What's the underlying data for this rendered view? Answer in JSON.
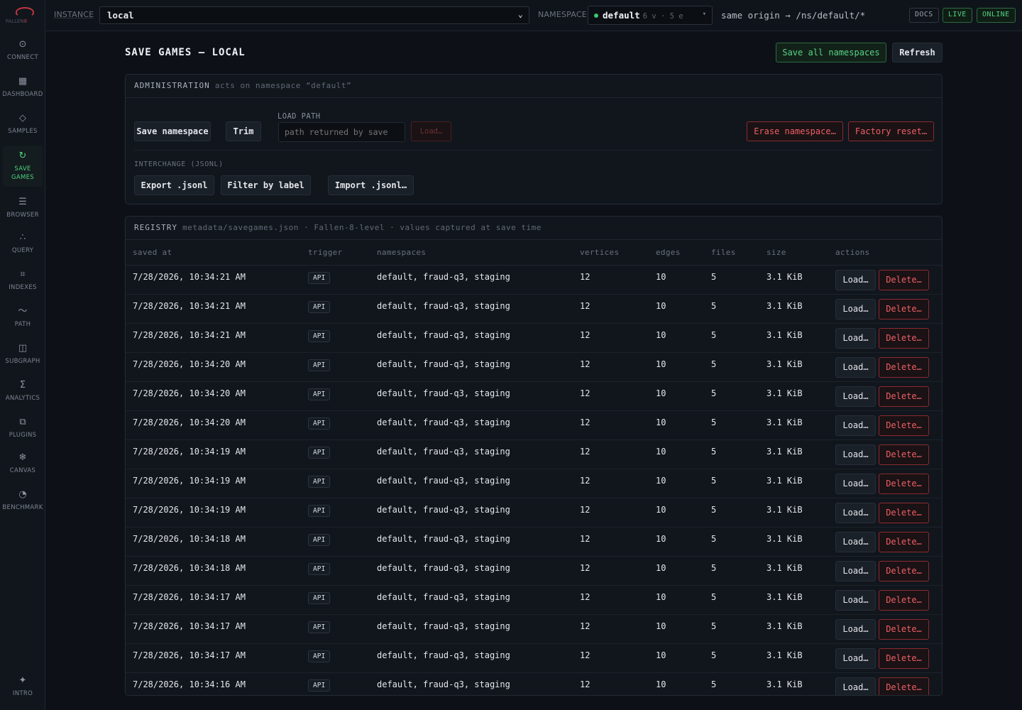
{
  "brand": {
    "wordmark_left": "FALLEN",
    "wordmark_right": "8"
  },
  "sidebar": {
    "items": [
      {
        "label": "CONNECT",
        "icon": "target-icon",
        "glyph": "⊙"
      },
      {
        "label": "DASHBOARD",
        "icon": "grid-icon",
        "glyph": "▦"
      },
      {
        "label": "SAMPLES",
        "icon": "diamond-icon",
        "glyph": "◇"
      },
      {
        "label": "SAVE GAMES",
        "icon": "refresh-icon",
        "glyph": "↻",
        "active": true
      },
      {
        "label": "BROWSER",
        "icon": "list-icon",
        "glyph": "☰"
      },
      {
        "label": "QUERY",
        "icon": "nodes-icon",
        "glyph": "∴"
      },
      {
        "label": "INDEXES",
        "icon": "frame-icon",
        "glyph": "⌗"
      },
      {
        "label": "PATH",
        "icon": "wave-icon",
        "glyph": "〜"
      },
      {
        "label": "SUBGRAPH",
        "icon": "square-icon",
        "glyph": "◫"
      },
      {
        "label": "ANALYTICS",
        "icon": "sigma-icon",
        "glyph": "Σ"
      },
      {
        "label": "PLUGINS",
        "icon": "plugin-icon",
        "glyph": "⧉"
      },
      {
        "label": "CANVAS",
        "icon": "canvas-icon",
        "glyph": "❄"
      },
      {
        "label": "BENCHMARK",
        "icon": "gauge-icon",
        "glyph": "◔"
      }
    ],
    "intro": {
      "label": "INTRO",
      "icon": "sparkle-icon",
      "glyph": "✦"
    }
  },
  "topbar": {
    "instance_label": "INSTANCE",
    "instance_value": "local",
    "namespace_label": "NAMESPACE",
    "namespace_value": "default",
    "namespace_counts": "6 v · 5 e",
    "origin": "same origin → /ns/default/*",
    "docs": "DOCS",
    "live": "LIVE",
    "online": "ONLINE"
  },
  "page": {
    "title": "SAVE GAMES — LOCAL",
    "save_all_label": "Save all namespaces",
    "refresh_label": "Refresh"
  },
  "admin": {
    "title": "ADMINISTRATION",
    "subtitle": "acts on namespace “default”",
    "save_namespace": "Save namespace",
    "trim": "Trim",
    "load_path_label": "LOAD PATH",
    "load_path_placeholder": "path returned by save",
    "load_button": "Load…",
    "erase_namespace": "Erase namespace…",
    "factory_reset": "Factory reset…",
    "interchange_label": "INTERCHANGE (JSONL)",
    "export": "Export .jsonl",
    "filter": "Filter by label",
    "import": "Import .jsonl…"
  },
  "registry": {
    "title": "REGISTRY",
    "path": "metadata/savegames.json",
    "note1": "Fallen-8-level",
    "note2": "values captured at save time",
    "columns": [
      "saved at",
      "trigger",
      "namespaces",
      "vertices",
      "edges",
      "files",
      "size",
      "actions"
    ],
    "load_label": "Load…",
    "delete_label": "Delete…",
    "rows": [
      {
        "saved_at": "7/28/2026, 10:34:21 AM",
        "trigger": "API",
        "namespaces": "default, fraud-q3, staging",
        "vertices": "12",
        "edges": "10",
        "files": "5",
        "size": "3.1 KiB"
      },
      {
        "saved_at": "7/28/2026, 10:34:21 AM",
        "trigger": "API",
        "namespaces": "default, fraud-q3, staging",
        "vertices": "12",
        "edges": "10",
        "files": "5",
        "size": "3.1 KiB"
      },
      {
        "saved_at": "7/28/2026, 10:34:21 AM",
        "trigger": "API",
        "namespaces": "default, fraud-q3, staging",
        "vertices": "12",
        "edges": "10",
        "files": "5",
        "size": "3.1 KiB"
      },
      {
        "saved_at": "7/28/2026, 10:34:20 AM",
        "trigger": "API",
        "namespaces": "default, fraud-q3, staging",
        "vertices": "12",
        "edges": "10",
        "files": "5",
        "size": "3.1 KiB"
      },
      {
        "saved_at": "7/28/2026, 10:34:20 AM",
        "trigger": "API",
        "namespaces": "default, fraud-q3, staging",
        "vertices": "12",
        "edges": "10",
        "files": "5",
        "size": "3.1 KiB"
      },
      {
        "saved_at": "7/28/2026, 10:34:20 AM",
        "trigger": "API",
        "namespaces": "default, fraud-q3, staging",
        "vertices": "12",
        "edges": "10",
        "files": "5",
        "size": "3.1 KiB"
      },
      {
        "saved_at": "7/28/2026, 10:34:19 AM",
        "trigger": "API",
        "namespaces": "default, fraud-q3, staging",
        "vertices": "12",
        "edges": "10",
        "files": "5",
        "size": "3.1 KiB"
      },
      {
        "saved_at": "7/28/2026, 10:34:19 AM",
        "trigger": "API",
        "namespaces": "default, fraud-q3, staging",
        "vertices": "12",
        "edges": "10",
        "files": "5",
        "size": "3.1 KiB"
      },
      {
        "saved_at": "7/28/2026, 10:34:19 AM",
        "trigger": "API",
        "namespaces": "default, fraud-q3, staging",
        "vertices": "12",
        "edges": "10",
        "files": "5",
        "size": "3.1 KiB"
      },
      {
        "saved_at": "7/28/2026, 10:34:18 AM",
        "trigger": "API",
        "namespaces": "default, fraud-q3, staging",
        "vertices": "12",
        "edges": "10",
        "files": "5",
        "size": "3.1 KiB"
      },
      {
        "saved_at": "7/28/2026, 10:34:18 AM",
        "trigger": "API",
        "namespaces": "default, fraud-q3, staging",
        "vertices": "12",
        "edges": "10",
        "files": "5",
        "size": "3.1 KiB"
      },
      {
        "saved_at": "7/28/2026, 10:34:17 AM",
        "trigger": "API",
        "namespaces": "default, fraud-q3, staging",
        "vertices": "12",
        "edges": "10",
        "files": "5",
        "size": "3.1 KiB"
      },
      {
        "saved_at": "7/28/2026, 10:34:17 AM",
        "trigger": "API",
        "namespaces": "default, fraud-q3, staging",
        "vertices": "12",
        "edges": "10",
        "files": "5",
        "size": "3.1 KiB"
      },
      {
        "saved_at": "7/28/2026, 10:34:17 AM",
        "trigger": "API",
        "namespaces": "default, fraud-q3, staging",
        "vertices": "12",
        "edges": "10",
        "files": "5",
        "size": "3.1 KiB"
      },
      {
        "saved_at": "7/28/2026, 10:34:16 AM",
        "trigger": "API",
        "namespaces": "default, fraud-q3, staging",
        "vertices": "12",
        "edges": "10",
        "files": "5",
        "size": "3.1 KiB"
      }
    ]
  },
  "colors": {
    "background": "#0d1117",
    "panel": "#11161d",
    "accent_green": "#52d181",
    "danger_red": "#ee5f66"
  }
}
